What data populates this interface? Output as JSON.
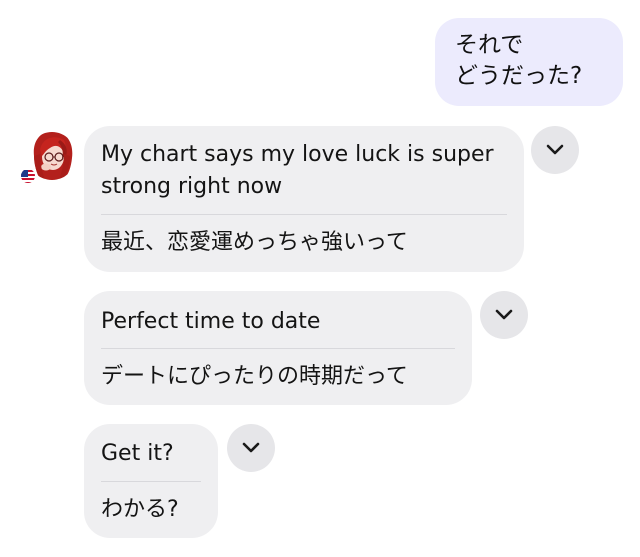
{
  "conversation": {
    "outgoing": {
      "text": "それで\nどうだった?"
    },
    "incoming": [
      {
        "original": "My chart says my love luck is super strong right now",
        "translation": "最近、恋愛運めっちゃ強いって",
        "toggle_icon": "chevron-down-icon"
      },
      {
        "original": "Perfect time to date",
        "translation": "デートにぴったりの時期だって",
        "toggle_icon": "chevron-down-icon"
      },
      {
        "original": "Get it?",
        "translation": "わかる?",
        "toggle_icon": "chevron-down-icon"
      }
    ],
    "sender": {
      "avatar_icon": "avatar-red-hair-character",
      "flag_icon": "us-flag-icon"
    }
  },
  "colors": {
    "outgoing_bubble": "#ecebfd",
    "incoming_bubble": "#efeff1",
    "chevron_button": "#e6e6e9",
    "text": "#111111"
  }
}
